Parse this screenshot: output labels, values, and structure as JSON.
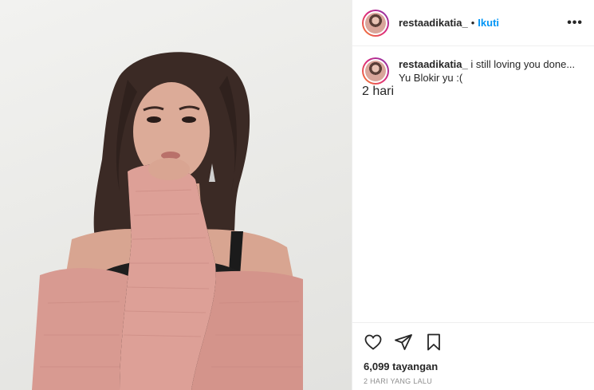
{
  "post": {
    "username": "restaadikatia_",
    "separator": "•",
    "follow_label": "Ikuti",
    "more_label": "•••",
    "caption_text": "i still loving you done...",
    "caption_line2": "Yu Blokir yu :(",
    "caption_time": "2 hari",
    "views": "6,099 tayangan",
    "date": "2 HARI YANG LALU"
  },
  "icons": {
    "like": "heart-icon",
    "share": "paper-plane-icon",
    "save": "bookmark-icon",
    "more": "more-options-icon"
  },
  "colors": {
    "follow": "#0095f6",
    "text": "#262626",
    "muted": "#8e8e8e",
    "sweater": "#d99a92"
  }
}
